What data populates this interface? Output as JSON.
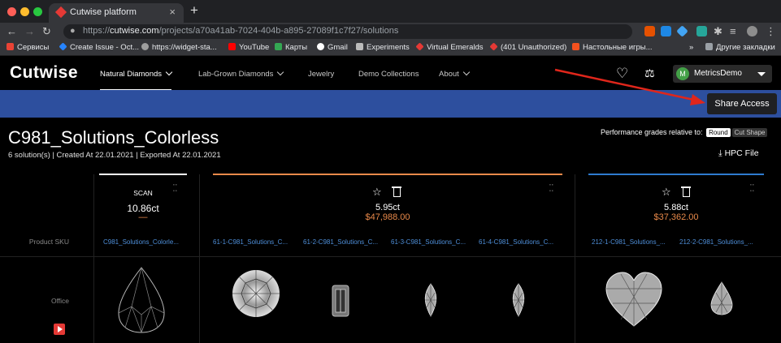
{
  "browser": {
    "tab_title": "Cutwise platform",
    "url_host": "cutwise.com",
    "url_prefix": "https://",
    "url_path": "/projects/a70a41ab-7024-404b-a895-27089f1c7f27/solutions",
    "bookmarks": [
      "Сервисы",
      "Create Issue - Oct...",
      "https://widget-sta...",
      "YouTube",
      "Карты",
      "Gmail",
      "Experiments",
      "Virtual Emeralds",
      "(401 Unauthorized)",
      "Настольные игры..."
    ],
    "bookmarks_more": "»",
    "other_bookmarks": "Другие закладки"
  },
  "header": {
    "logo": "Cutwise",
    "nav": [
      "Natural Diamonds",
      "Lab-Grown Diamonds",
      "Jewelry",
      "Demo Collections",
      "About"
    ],
    "user_initial": "M",
    "user_name": "MetricsDemo",
    "share_label": "Share Access"
  },
  "project": {
    "title": "C981_Solutions_Colorless",
    "meta": "6 solution(s) | Created At 22.01.2021 | Exported At 22.01.2021",
    "perf_label": "Performance grades relative to:",
    "perf_options": [
      "Round",
      "Cut Shape"
    ],
    "hpc_label": "HPC File"
  },
  "rows": {
    "sku_label": "Product SKU",
    "office_label": "Office"
  },
  "cards": {
    "scan": {
      "label": "SCAN",
      "weight": "10.86ct",
      "dash": "—",
      "sku": "C981_Solutions_Colorle..."
    },
    "group1": {
      "weight": "5.95ct",
      "price": "$47,988.00",
      "skus": [
        "61-1-C981_Solutions_C...",
        "61-2-C981_Solutions_C...",
        "61-3-C981_Solutions_C...",
        "61-4-C981_Solutions_C..."
      ]
    },
    "group2": {
      "weight": "5.88ct",
      "price": "$37,362.00",
      "skus": [
        "212-1-C981_Solutions_...",
        "212-2-C981_Solutions_..."
      ]
    }
  },
  "colors": {
    "accent_blue": "#2d4f9e",
    "price_orange": "#e8894a",
    "sku_link": "#4e8ed8",
    "group1_bar": "#e8894a",
    "group2_bar": "#2e7bcf"
  }
}
